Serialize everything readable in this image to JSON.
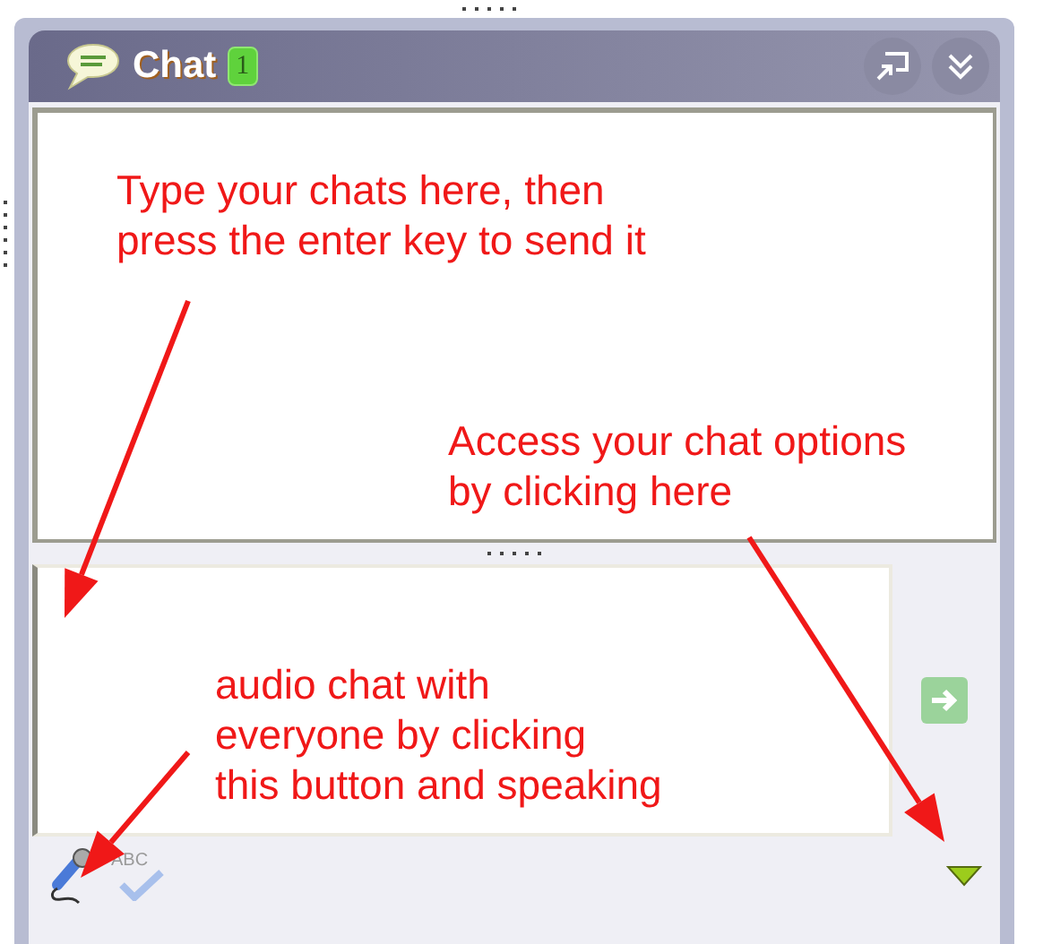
{
  "panel": {
    "title": "Chat",
    "badge": "1"
  },
  "toolbar": {
    "spellcheck_label": "ABC"
  },
  "annotations": [
    {
      "lines": [
        "Type your chats here, then",
        "press the enter key to send it"
      ]
    },
    {
      "lines": [
        "Access your chat options",
        "by clicking here"
      ]
    },
    {
      "lines": [
        "audio chat with",
        "everyone by clicking",
        "this button and speaking"
      ]
    }
  ]
}
